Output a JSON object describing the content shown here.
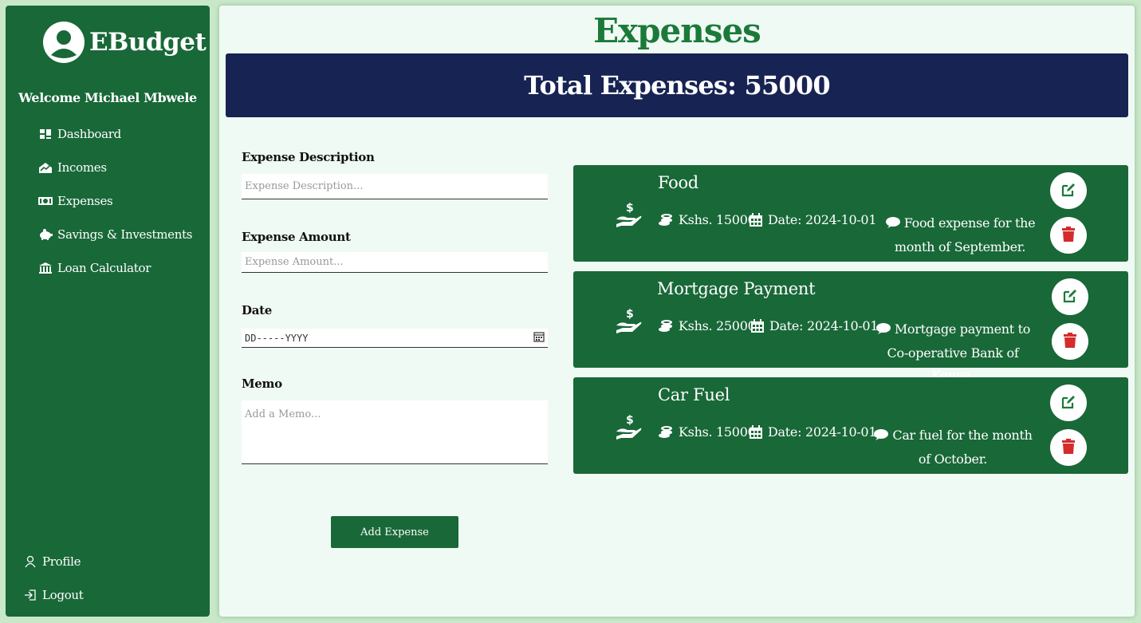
{
  "app": {
    "title": "EBudget",
    "welcome": "Welcome Michael Mbwele"
  },
  "sidebar": {
    "items": [
      {
        "label": "Dashboard",
        "icon": "dashboard-icon"
      },
      {
        "label": "Incomes",
        "icon": "chart-house-icon"
      },
      {
        "label": "Expenses",
        "icon": "money-bill-icon"
      },
      {
        "label": "Savings & Investments",
        "icon": "piggy-bank-icon"
      },
      {
        "label": "Loan Calculator",
        "icon": "bank-icon"
      }
    ],
    "bottom": [
      {
        "label": "Profile",
        "icon": "person-icon"
      },
      {
        "label": "Logout",
        "icon": "logout-icon"
      }
    ]
  },
  "main": {
    "title": "Expenses",
    "total": "Total Expenses: 55000"
  },
  "form": {
    "description_label": "Expense Description",
    "description_placeholder": "Expense Description...",
    "amount_label": "Expense Amount",
    "amount_placeholder": "Expense Amount...",
    "date_label": "Date",
    "date_placeholder": "DD-----YYYY",
    "memo_label": "Memo",
    "memo_placeholder": "Add a Memo...",
    "submit_label": "Add Expense"
  },
  "expenses": [
    {
      "title": "Food",
      "amount": "Kshs. 15000",
      "date": "Date: 2024-10-01",
      "memo": "Food expense for the month of September."
    },
    {
      "title": "Mortgage Payment",
      "amount": "Kshs. 25000",
      "date": "Date: 2024-10-01",
      "memo": "Mortgage payment to Co-operative Bank of Kenya."
    },
    {
      "title": "Car Fuel",
      "amount": "Kshs. 15000",
      "date": "Date: 2024-10-01",
      "memo": "Car fuel for the month of October."
    }
  ],
  "colors": {
    "sidebar_bg": "#196838",
    "banner_bg": "#172353",
    "title_green": "#1b7a3a",
    "edit_icon": "#1b7a3a",
    "delete_icon": "#d42b2b"
  }
}
